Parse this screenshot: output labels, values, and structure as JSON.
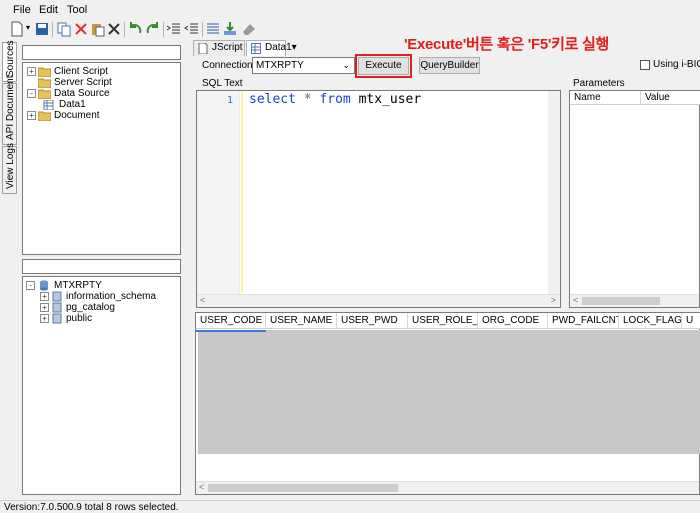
{
  "menu": [
    "File",
    "Edit",
    "Tool"
  ],
  "sidetabs": [
    "Sources",
    "API Document",
    "View Logs"
  ],
  "source_tree": [
    {
      "label": "Client Script",
      "level": 0,
      "expander": "+"
    },
    {
      "label": "Server Script",
      "level": 0,
      "expander": ""
    },
    {
      "label": "Data Source",
      "level": 0,
      "expander": "-"
    },
    {
      "label": "Data1",
      "level": 1,
      "expander": ""
    },
    {
      "label": "Document",
      "level": 0,
      "expander": "+"
    }
  ],
  "db_tree": {
    "root": "MTXRPTY",
    "children": [
      "information_schema",
      "pg_catalog",
      "public"
    ]
  },
  "editor_tabs": [
    "JScript",
    "Data1▾"
  ],
  "connection": {
    "label": "Connection",
    "value": "MTXRPTY"
  },
  "buttons": {
    "execute": "Execute",
    "query_builder": "QueryBuilder"
  },
  "using_checkbox": "Using i-BIG",
  "annotation": "'Execute'버튼 혹은 'F5'키로 실행",
  "sql": {
    "label": "SQL Text",
    "line_number": "1",
    "tokens": {
      "select": "select",
      "star": "*",
      "from": "from",
      "table": "mtx_user"
    }
  },
  "parameters": {
    "label": "Parameters",
    "columns": [
      "Name",
      "Value"
    ]
  },
  "grid_columns": [
    "USER_CODE",
    "USER_NAME",
    "USER_PWD",
    "USER_ROLE_NO",
    "ORG_CODE",
    "PWD_FAILCNT",
    "LOCK_FLAG",
    "U"
  ],
  "status": "Version:7.0.500.9  total 8 rows selected.",
  "colors": {
    "annotation": "#e21b1b",
    "keyword": "#1a3fd6",
    "highlight_box": "#e02020"
  }
}
